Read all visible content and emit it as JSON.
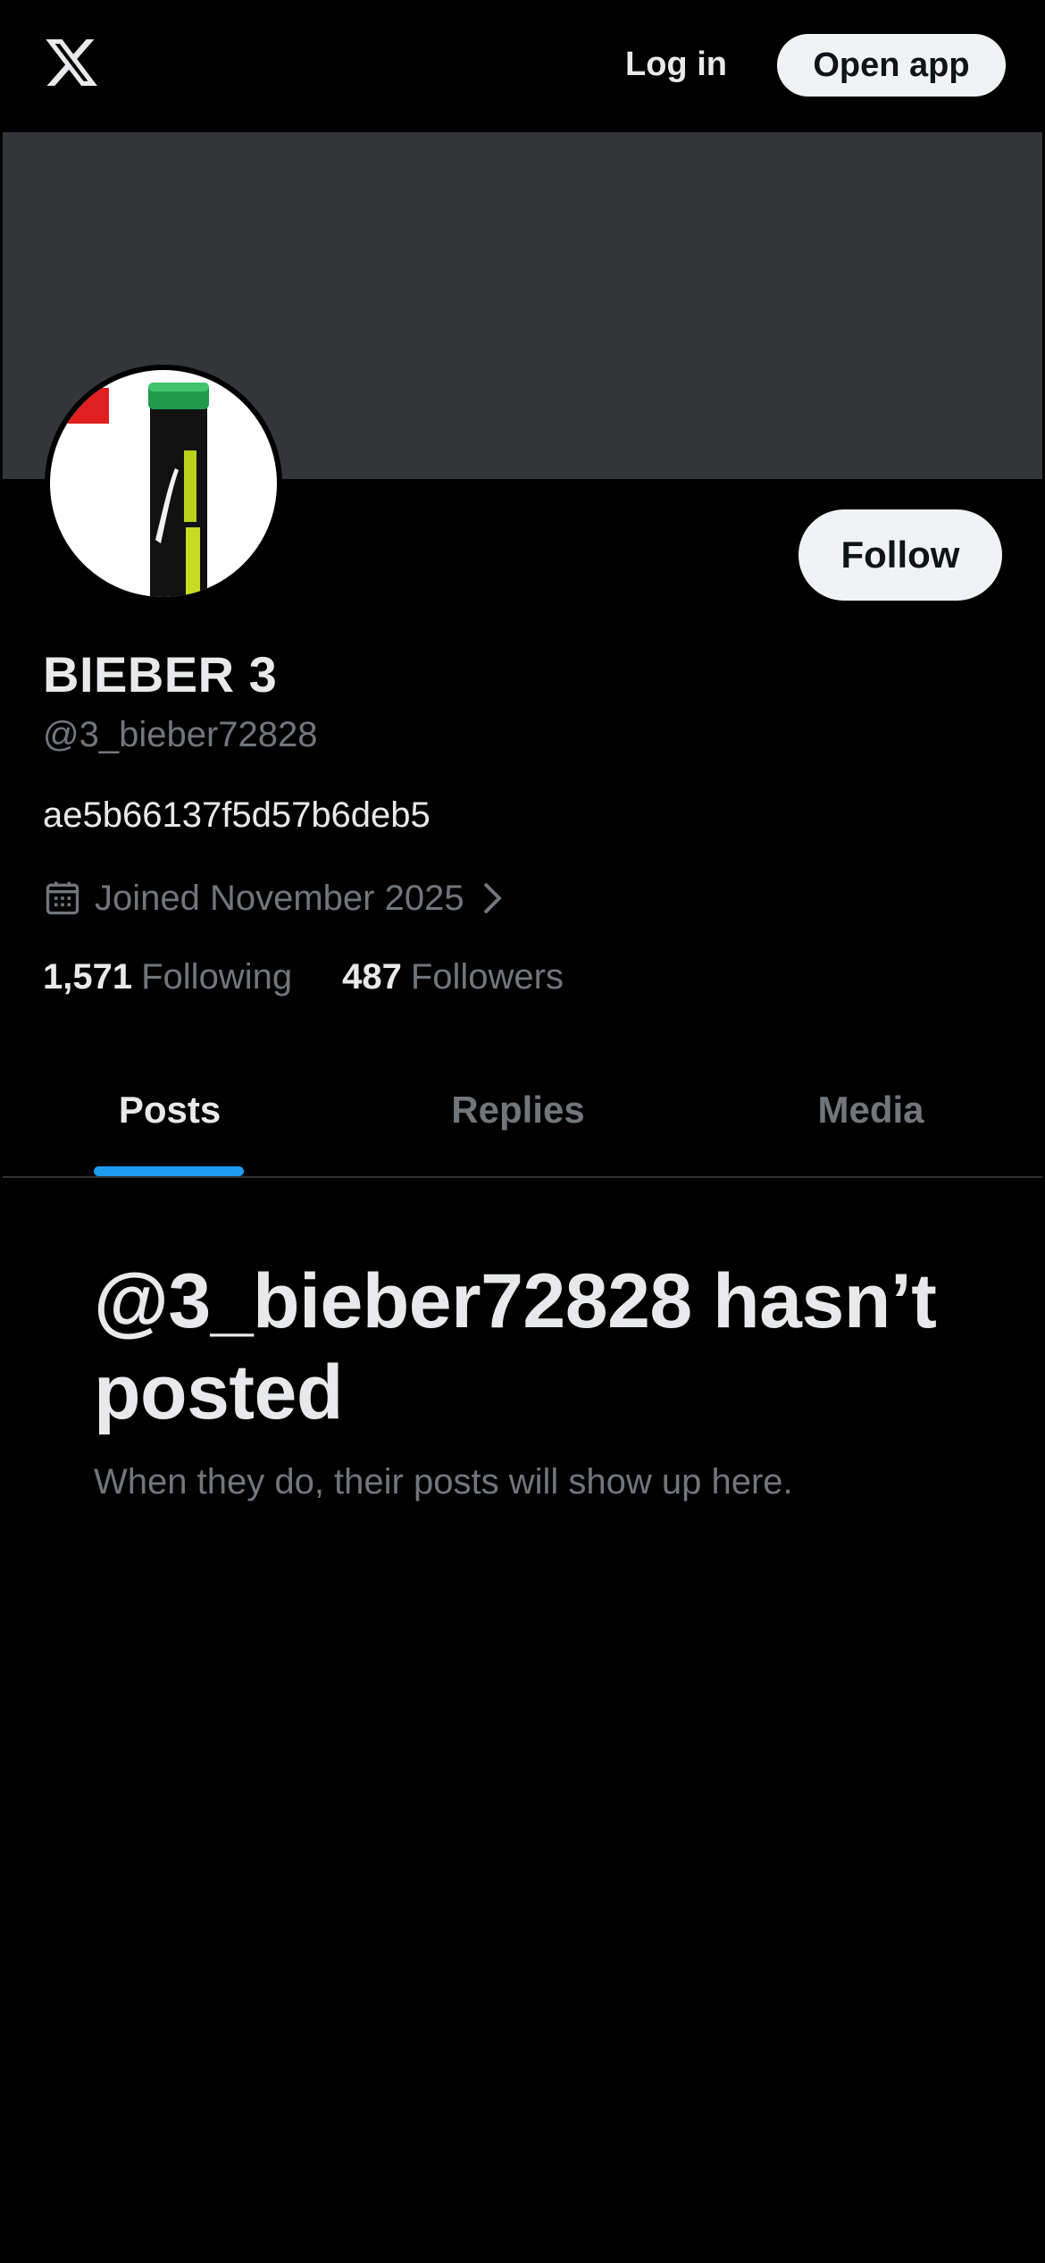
{
  "header": {
    "logo_icon": "x-logo-icon",
    "login_label": "Log in",
    "open_app_label": "Open app"
  },
  "profile": {
    "display_name": "BIEBER 3",
    "handle": "@3_bieber72828",
    "bio": "ae5b66137f5d57b6deb5",
    "joined": "Joined November 2025",
    "follow_label": "Follow",
    "avatar_icon": "badminton-shuttle-tube-avatar",
    "stats": {
      "following_count": "1,571",
      "following_label": "Following",
      "followers_count": "487",
      "followers_label": "Followers"
    }
  },
  "tabs": [
    {
      "label": "Posts",
      "active": true
    },
    {
      "label": "Replies",
      "active": false
    },
    {
      "label": "Media",
      "active": false
    }
  ],
  "empty_state": {
    "title": "@3_bieber72828 hasn’t posted",
    "subtitle": "When they do, their posts will show up here."
  },
  "colors": {
    "background": "#000000",
    "banner": "#333639",
    "accent": "#1d9bf0",
    "text_primary": "#e7e9ea",
    "text_secondary": "#71767b",
    "button_bg": "#eff3f4"
  }
}
